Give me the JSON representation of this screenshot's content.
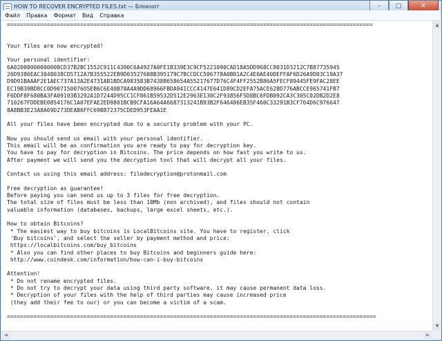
{
  "window": {
    "title": "HOW TO RECOVER ENCRYPTED FILES.txt — Блокнот"
  },
  "controls": {
    "minimize": "–",
    "maximize": "□",
    "close": "✕"
  },
  "menu": [
    "Файл",
    "Правка",
    "Формат",
    "Вид",
    "Справка"
  ],
  "scrollbar": {
    "up": "▲",
    "down": "▼",
    "left": "◄",
    "right": "►"
  },
  "content": {
    "lines": [
      "==============================================================================================================",
      "",
      "",
      "Your files are now encrypted!",
      "",
      "Your personal identifier:",
      "6A02000000000000CD37B2BC1552C911C4300C6A4927A0FE1B339E3C9CF5221090CAD18A5DD968CC8031D3212C7B87735945",
      "26D9386EAC3048038CD5712A7B355522EB9D03527688B395179C7BCCDCC506778A0B01A2C4E0AE40DEFFAF6D26A9D03C19A37",
      "D9D91BAAAF2E1AEC737A13A2E4731AB1BDCA983583B7438B658654A55217677D76C4F4FF2552B86A5FECF89445FE9FAC28EE",
      "EC19B39BD8CC0D907150076O5EB6C6E40B78A4A9DD68966FBDA941CCC4147E641D89CD2EFA75ACE628D776ABCCE965741FB7",
      "F6DDF8F680BA3FA09103B3292A1D7244D95CC1CF861B59532D512E2963E130C2F93856F5D8BC6FDB092CA3C305C02DB2D2E8",
      "710267FDDEBE0854176C1A07EFAE2ED9801BCB9CFA16A64A6687313241B93B2F646486EB35F460C33291B3CF764D6C976647",
      "8A8BB3E23A8A69D273DEAB6FFC69B872375CDED953FEAA1E",
      "",
      "All your files have been encrypted due to a security problem with your PC.",
      "",
      "Now you should send us email with your personal identifier.",
      "This email will be as confirmation you are ready to pay for decryption key.",
      "You have to pay for decryption in Bitcoins. The price depends on how fast you write to us.",
      "After payment we will send you the decryption tool that will decrypt all your files.",
      "",
      "Contact us using this email address: filedecryption@protonmail.com",
      "",
      "Free decryption as guarantee!",
      "Before paying you can send us up to 3 files for free decryption.",
      "The total size of files must be less than 10Mb (non archived), and files should not contain",
      "valuable information (databases, backups, large excel sheets, etc.).",
      "",
      "How to obtain Bitcoins?",
      " * The easiest way to buy bitcoins is LocalBitcoins site. You have to register, click",
      " 'Buy bitcoins', and select the seller by payment method and price:",
      " https://localbitcoins.com/buy_bitcoins",
      " * Also you can find other places to buy Bitcoins and beginners guide here:",
      " http://www.coindesk.com/information/how-can-i-buy-bitcoins",
      "",
      "Attention!",
      " * Do not rename encrypted files.",
      " * Do not try to decrypt your data using third party software, it may cause permanent data loss.",
      " * Decryption of your files with the help of third parties may cause increased price",
      " (they add their fee to our) or you can become a victim of a scam.",
      "",
      "==============================================================================================================="
    ]
  }
}
